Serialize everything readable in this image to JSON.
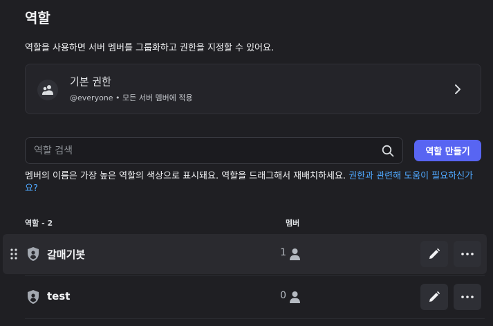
{
  "page": {
    "title": "역할",
    "description": "역할을 사용하면 서버 멤버를 그룹화하고 권한을 지정할 수 있어요."
  },
  "default_permissions": {
    "title": "기본 권한",
    "subtitle": "@everyone • 모든 서버 멤버에 적용",
    "icon": "people-icon",
    "chevron": "chevron-right-icon"
  },
  "search": {
    "placeholder": "역할 검색",
    "value": "",
    "icon": "search-icon"
  },
  "create_button": {
    "label": "역할 만들기"
  },
  "help": {
    "text": "멤버의 이름은 가장 높은 역할의 색상으로 표시돼요. 역할을 드래그해서 재배치하세요. ",
    "link": "권한과 관련해 도움이 필요하신가요?"
  },
  "table": {
    "header_roles": "역할 - 2",
    "header_members": "멤버",
    "rows": [
      {
        "name": "갈매기봇",
        "members": "1",
        "hovered": true
      },
      {
        "name": "test",
        "members": "0",
        "hovered": false
      }
    ]
  },
  "colors": {
    "background": "#1f1f23",
    "accent": "#5865f2",
    "link": "#4fa8ff",
    "hover_row": "#2a2a2f"
  }
}
